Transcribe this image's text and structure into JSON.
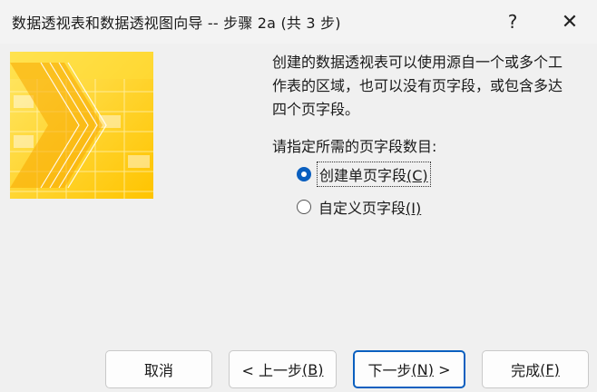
{
  "window": {
    "title": "数据透视表和数据透视图向导 -- 步骤 2a (共 3 步)",
    "help_glyph": "?",
    "close_glyph": "✕"
  },
  "description": {
    "lines": [
      "创建的数据透视表可以使用源自一个或多个工",
      "作表的区域，也可以没有页字段，或包含多达",
      "四个页字段。"
    ]
  },
  "page_fields": {
    "prompt": "请指定所需的页字段数目:",
    "options": [
      {
        "label": "创建单页字段",
        "key": "(C)",
        "selected": true
      },
      {
        "label": "自定义页字段",
        "key": "(I)",
        "selected": false
      }
    ]
  },
  "buttons": {
    "cancel": "取消",
    "back_prefix": "< 上一步",
    "back_key": "(B)",
    "next_prefix": "下一步",
    "next_key": "(N)",
    "next_suffix": " >",
    "finish_prefix": "完成",
    "finish_key": "(F)"
  },
  "colors": {
    "accent": "#0a5fbf",
    "image_yellow": "#ffd21a",
    "image_orange": "#f7a800"
  }
}
